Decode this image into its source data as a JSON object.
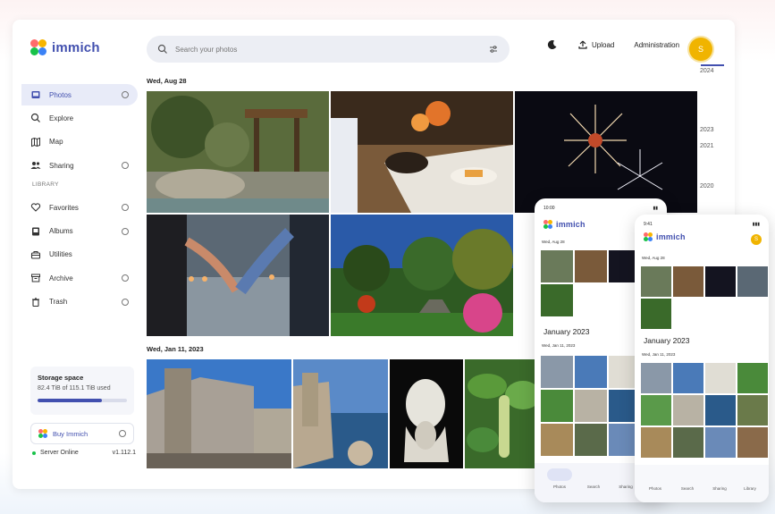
{
  "app": {
    "name": "immich"
  },
  "search": {
    "placeholder": "Search your photos"
  },
  "header": {
    "upload_label": "Upload",
    "admin_label": "Administration",
    "avatar_initial": "S"
  },
  "sidebar": {
    "items": [
      {
        "label": "Photos",
        "icon": "photos-icon"
      },
      {
        "label": "Explore",
        "icon": "search-icon"
      },
      {
        "label": "Map",
        "icon": "map-icon"
      },
      {
        "label": "Sharing",
        "icon": "sharing-icon"
      }
    ],
    "library_label": "LIBRARY",
    "library_items": [
      {
        "label": "Favorites",
        "icon": "heart-icon"
      },
      {
        "label": "Albums",
        "icon": "album-icon"
      },
      {
        "label": "Utilities",
        "icon": "toolbox-icon"
      },
      {
        "label": "Archive",
        "icon": "archive-icon"
      },
      {
        "label": "Trash",
        "icon": "trash-icon"
      }
    ]
  },
  "storage": {
    "title": "Storage space",
    "used_text": "82.4 TiB of 115.1 TiB used",
    "used_fraction": 0.716
  },
  "buy": {
    "label": "Buy Immich"
  },
  "server": {
    "status": "Server Online",
    "version": "v1.112.1"
  },
  "groups": [
    {
      "date": "Wed, Aug 28"
    },
    {
      "date": "Wed, Jan 11, 2023"
    }
  ],
  "timeline": {
    "years": [
      "2024",
      "2023",
      "2021",
      "2020"
    ]
  },
  "phone_android": {
    "time": "10:00",
    "date1": "Wed, Aug 28",
    "month": "January 2023",
    "date2": "Wed, Jan 11, 2023",
    "tabs": [
      "Photos",
      "Search",
      "Sharing"
    ]
  },
  "phone_ios": {
    "time": "9:41",
    "date1": "Wed, Aug 28",
    "month": "January 2023",
    "date2": "Wed, Jan 11, 2023",
    "tabs": [
      "Photos",
      "Search",
      "Sharing",
      "Library"
    ],
    "avatar_initial": "S"
  },
  "colors": {
    "accent": "#4250af",
    "avatar": "#f0b400",
    "online": "#18c249"
  }
}
